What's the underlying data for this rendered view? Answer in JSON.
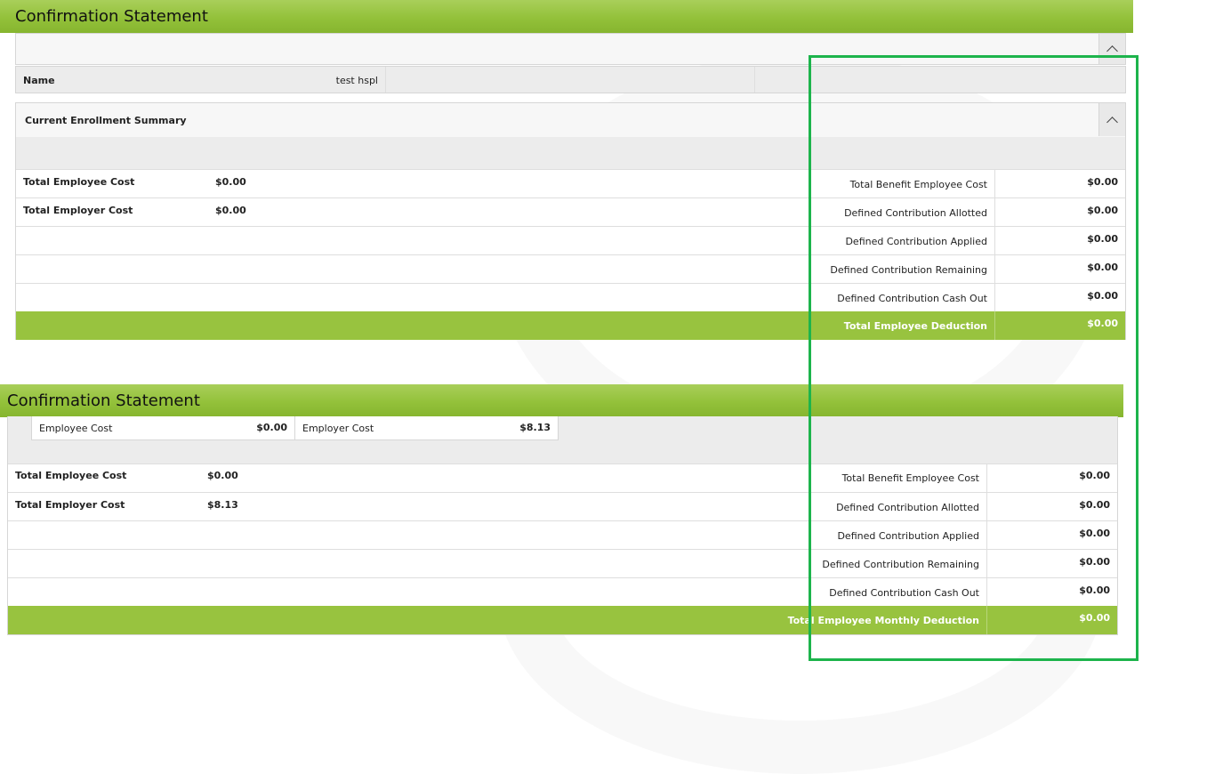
{
  "section1": {
    "header_title": "Confirmation Statement",
    "name_label": "Name",
    "name_value": "test hspl",
    "summary_title": "Current Enrollment Summary",
    "left_rows": [
      {
        "label": "Total Employee Cost",
        "value": "$0.00"
      },
      {
        "label": "Total Employer Cost",
        "value": "$0.00"
      }
    ],
    "right_rows": [
      {
        "label": "Total Benefit Employee Cost",
        "value": "$0.00"
      },
      {
        "label": "Defined Contribution Allotted",
        "value": "$0.00"
      },
      {
        "label": "Defined Contribution Applied",
        "value": "$0.00"
      },
      {
        "label": "Defined Contribution Remaining",
        "value": "$0.00"
      },
      {
        "label": "Defined Contribution Cash Out",
        "value": "$0.00"
      }
    ],
    "total": {
      "label": "Total Employee Deduction",
      "value": "$0.00"
    }
  },
  "section2": {
    "header_title": "Confirmation Statement",
    "employee_cost_label": "Employee Cost",
    "employee_cost_value": "$0.00",
    "employer_cost_label": "Employer Cost",
    "employer_cost_value": "$8.13",
    "left_rows": [
      {
        "label": "Total Employee Cost",
        "value": "$0.00"
      },
      {
        "label": "Total Employer Cost",
        "value": "$8.13"
      }
    ],
    "right_rows": [
      {
        "label": "Total Benefit Employee Cost",
        "value": "$0.00"
      },
      {
        "label": "Defined Contribution Allotted",
        "value": "$0.00"
      },
      {
        "label": "Defined Contribution Applied",
        "value": "$0.00"
      },
      {
        "label": "Defined Contribution Remaining",
        "value": "$0.00"
      },
      {
        "label": "Defined Contribution Cash Out",
        "value": "$0.00"
      }
    ],
    "total": {
      "label": "Total Employee Monthly Deduction",
      "value": "$0.00"
    }
  },
  "colors": {
    "header_green": "#93c13a",
    "total_row_green": "#98c33f",
    "highlight_green": "#1db44c"
  }
}
